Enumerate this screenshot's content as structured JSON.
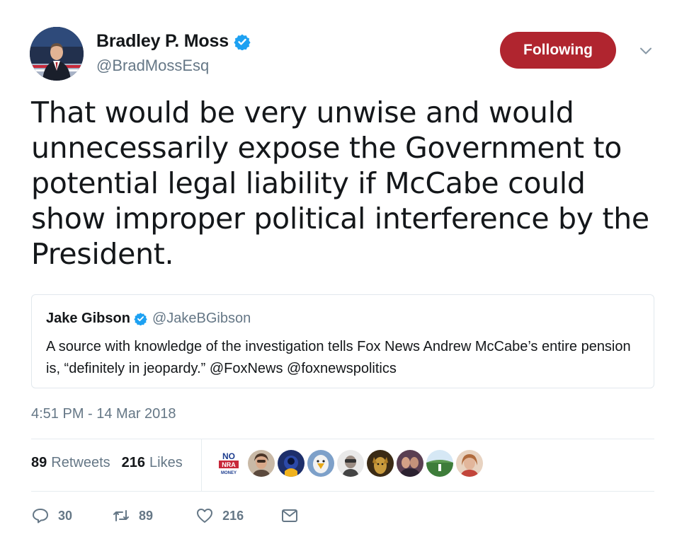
{
  "author": {
    "name": "Bradley P. Moss",
    "handle": "@BradMossEsq",
    "verified": true
  },
  "follow_button": {
    "label": "Following",
    "color": "#b0252f"
  },
  "tweet": {
    "text": "That would be very unwise and would unnecessarily expose the Government to potential legal liability if McCabe could show improper political interference by the President."
  },
  "quoted_tweet": {
    "name": "Jake Gibson",
    "handle": "@JakeBGibson",
    "verified": true,
    "text": "A source with knowledge of the investigation tells Fox News Andrew McCabe’s entire pension is, “definitely in jeopardy.” @FoxNews @foxnewspolitics"
  },
  "timestamp": "4:51 PM - 14 Mar 2018",
  "stats": {
    "retweets_count": "89",
    "retweets_label": "Retweets",
    "likes_count": "216",
    "likes_label": "Likes"
  },
  "likers_badge": {
    "line1": "NO",
    "line2": "NRA",
    "line3": "MONEY"
  },
  "actions": {
    "reply_count": "30",
    "retweet_count": "89",
    "like_count": "216"
  },
  "colors": {
    "text": "#14171a",
    "muted": "#657786",
    "verified_blue": "#1da1f2"
  },
  "icons": [
    "verified-badge-icon",
    "chevron-down-icon",
    "reply-icon",
    "retweet-icon",
    "heart-icon",
    "envelope-icon"
  ]
}
